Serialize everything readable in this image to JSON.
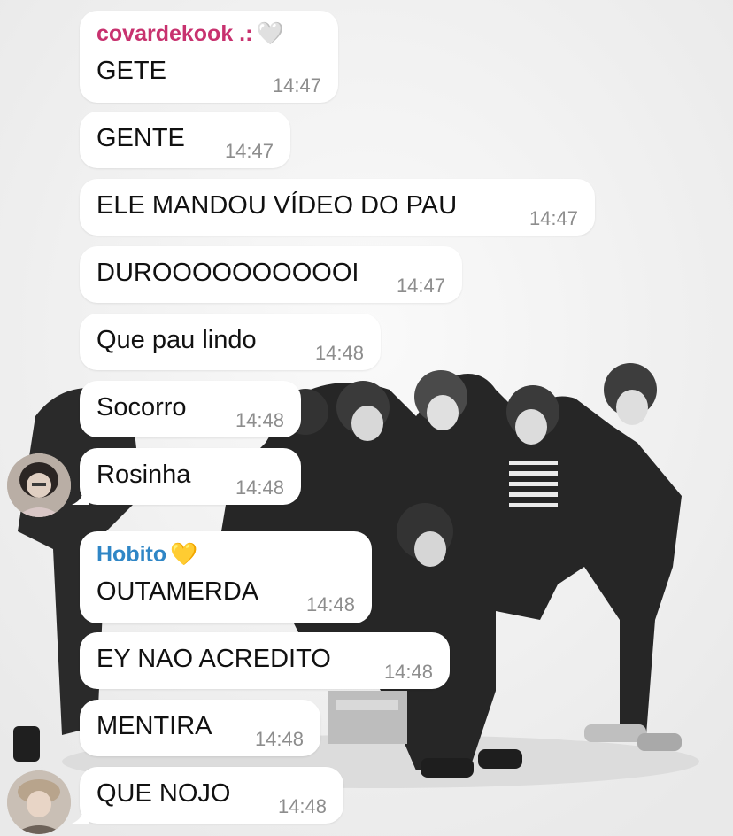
{
  "chat": {
    "messages": [
      {
        "sender": "covardekook .:",
        "heart": "🤍",
        "text": "GETE",
        "time": "14:47"
      },
      {
        "text": "GENTE",
        "time": "14:47"
      },
      {
        "text": "ELE MANDOU VÍDEO DO PAU",
        "time": "14:47"
      },
      {
        "text": "DUROOOOOOOOOOI",
        "time": "14:47"
      },
      {
        "text": "Que pau lindo",
        "time": "14:48"
      },
      {
        "text": "Socorro",
        "time": "14:48"
      },
      {
        "text": "Rosinha",
        "time": "14:48"
      },
      {
        "sender": "Hobito",
        "heart": "💛",
        "text": "OUTAMERDA",
        "time": "14:48"
      },
      {
        "text": "EY NAO ACREDITO",
        "time": "14:48"
      },
      {
        "text": "MENTIRA",
        "time": "14:48"
      },
      {
        "text": "QUE NOJO",
        "time": "14:48"
      }
    ]
  },
  "colors": {
    "sender_1": "#c8326f",
    "sender_2": "#2f86c6",
    "bubble": "#ffffff",
    "timestamp": "#8d8d8d",
    "background": "#f4f4f4"
  },
  "icons": {
    "avatar_1": "user-avatar",
    "avatar_2": "user-avatar"
  }
}
